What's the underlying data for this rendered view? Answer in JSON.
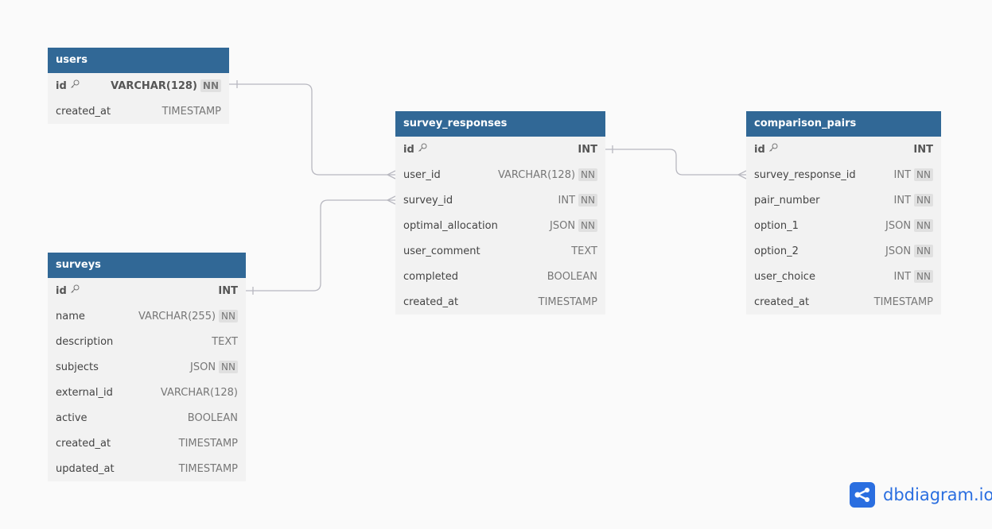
{
  "tables": {
    "users": {
      "name": "users",
      "fields": [
        {
          "name": "id",
          "type": "VARCHAR(128)",
          "nn": "NN",
          "pk": true
        },
        {
          "name": "created_at",
          "type": "TIMESTAMP"
        }
      ]
    },
    "surveys": {
      "name": "surveys",
      "fields": [
        {
          "name": "id",
          "type": "INT",
          "pk": true
        },
        {
          "name": "name",
          "type": "VARCHAR(255)",
          "nn": "NN"
        },
        {
          "name": "description",
          "type": "TEXT"
        },
        {
          "name": "subjects",
          "type": "JSON",
          "nn": "NN"
        },
        {
          "name": "external_id",
          "type": "VARCHAR(128)"
        },
        {
          "name": "active",
          "type": "BOOLEAN"
        },
        {
          "name": "created_at",
          "type": "TIMESTAMP"
        },
        {
          "name": "updated_at",
          "type": "TIMESTAMP"
        }
      ]
    },
    "survey_responses": {
      "name": "survey_responses",
      "fields": [
        {
          "name": "id",
          "type": "INT",
          "pk": true
        },
        {
          "name": "user_id",
          "type": "VARCHAR(128)",
          "nn": "NN"
        },
        {
          "name": "survey_id",
          "type": "INT",
          "nn": "NN"
        },
        {
          "name": "optimal_allocation",
          "type": "JSON",
          "nn": "NN"
        },
        {
          "name": "user_comment",
          "type": "TEXT"
        },
        {
          "name": "completed",
          "type": "BOOLEAN"
        },
        {
          "name": "created_at",
          "type": "TIMESTAMP"
        }
      ]
    },
    "comparison_pairs": {
      "name": "comparison_pairs",
      "fields": [
        {
          "name": "id",
          "type": "INT",
          "pk": true
        },
        {
          "name": "survey_response_id",
          "type": "INT",
          "nn": "NN"
        },
        {
          "name": "pair_number",
          "type": "INT",
          "nn": "NN"
        },
        {
          "name": "option_1",
          "type": "JSON",
          "nn": "NN"
        },
        {
          "name": "option_2",
          "type": "JSON",
          "nn": "NN"
        },
        {
          "name": "user_choice",
          "type": "INT",
          "nn": "NN"
        },
        {
          "name": "created_at",
          "type": "TIMESTAMP"
        }
      ]
    }
  },
  "relationships": [
    {
      "from": "users.id",
      "to": "survey_responses.user_id",
      "type": "one-to-many"
    },
    {
      "from": "surveys.id",
      "to": "survey_responses.survey_id",
      "type": "one-to-many"
    },
    {
      "from": "survey_responses.id",
      "to": "comparison_pairs.survey_response_id",
      "type": "one-to-many"
    }
  ],
  "brand": {
    "text": "dbdiagram.io",
    "color": "#2a6ee0"
  },
  "colors": {
    "header": "#316896",
    "body": "#f2f2f2",
    "line": "#b8b8c0"
  }
}
